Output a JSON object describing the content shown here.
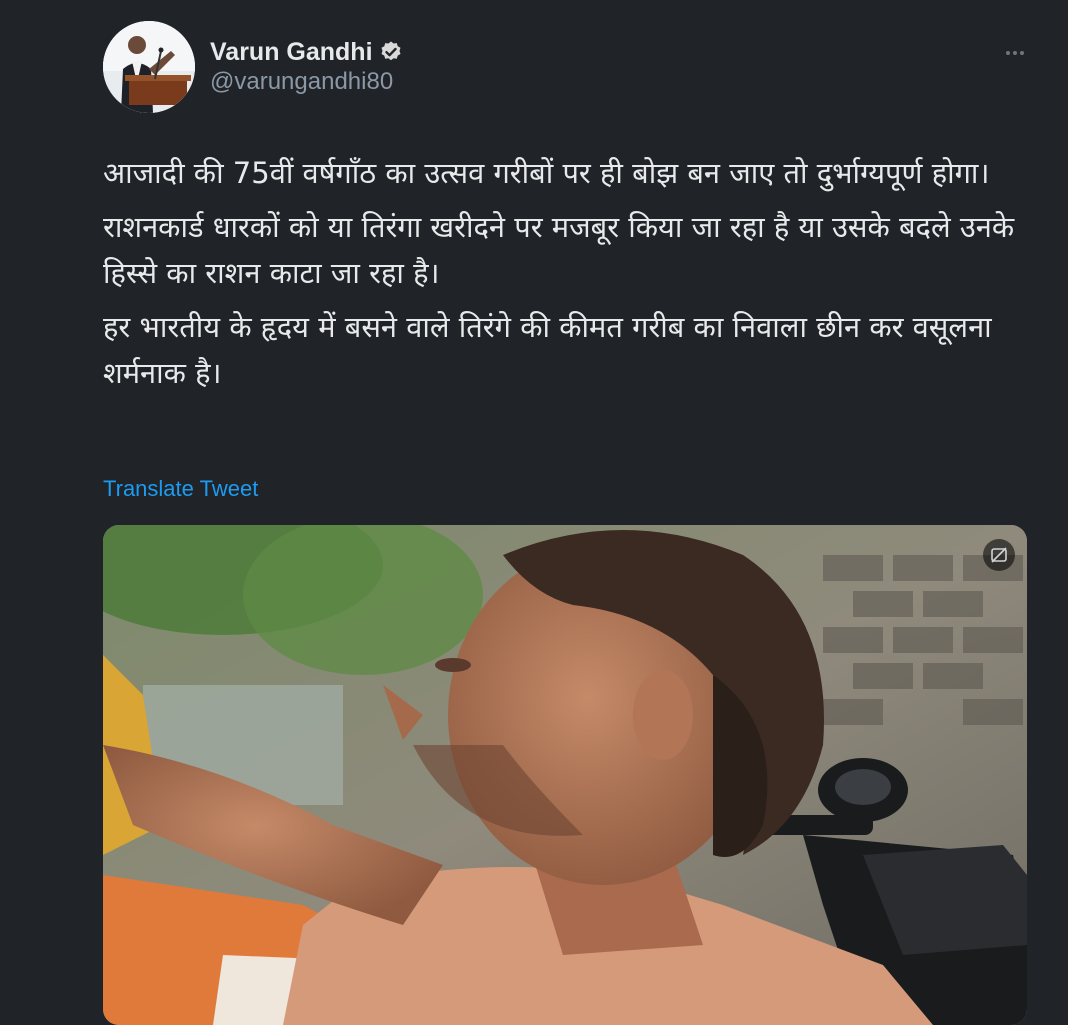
{
  "author": {
    "display_name": "Varun Gandhi",
    "handle": "@varungandhi80",
    "verified": true,
    "avatar_icon": "profile-photo"
  },
  "tweet": {
    "paragraphs": [
      "आजादी की 75वीं वर्षगाँठ का उत्सव गरीबों पर ही बोझ बन जाए तो दुर्भाग्यपूर्ण होगा।",
      "राशनकार्ड धारकों को या तिरंगा खरीदने पर मजबूर किया जा रहा है या उसके बदले उनके हिस्से का राशन काटा जा रहा है।",
      "हर भारतीय के हृदय में बसने वाले तिरंगे की कीमत गरीब का निवाला छीन कर वसूलना शर्मनाक है।"
    ],
    "translate_label": "Translate Tweet"
  },
  "icons": {
    "more": "more-options-icon",
    "verified": "verified-badge-icon",
    "media_badge": "media-sensitive-icon"
  },
  "colors": {
    "background": "#202327",
    "text": "#e7e9ea",
    "secondary": "#8b98a5",
    "accent": "#1d9bf0"
  }
}
